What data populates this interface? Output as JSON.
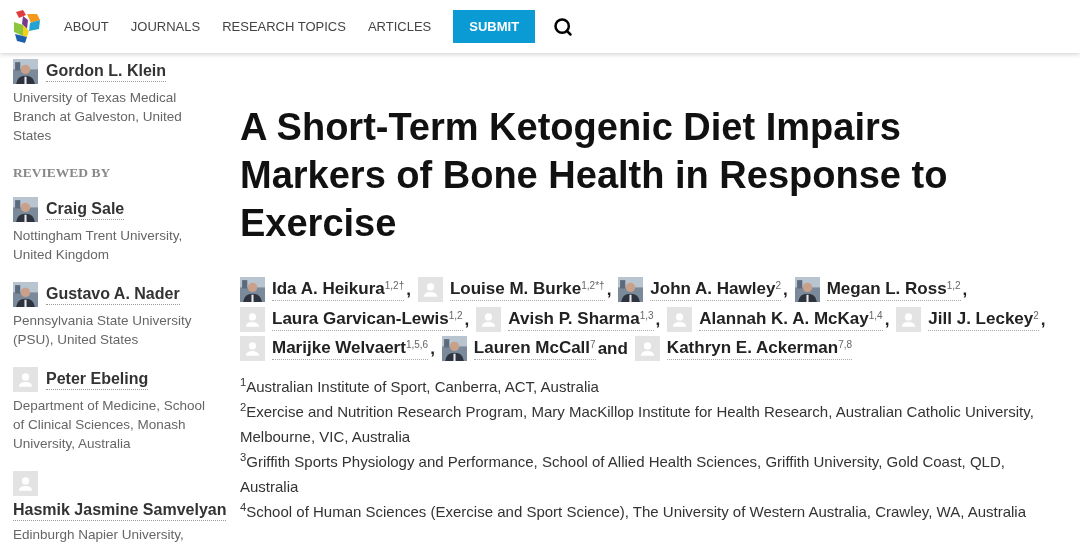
{
  "nav": {
    "items": [
      "ABOUT",
      "JOURNALS",
      "RESEARCH TOPICS",
      "ARTICLES"
    ],
    "submit": "SUBMIT"
  },
  "sidebar": {
    "edited_by": [
      {
        "name": "Gordon L. Klein",
        "affiliation": "University of Texas Medical Branch at Galveston, United States"
      }
    ],
    "reviewed_heading": "REVIEWED BY",
    "reviewers": [
      {
        "name": "Craig Sale",
        "affiliation": "Nottingham Trent University, United Kingdom"
      },
      {
        "name": "Gustavo A. Nader",
        "affiliation": "Pennsylvania State University (PSU), United States"
      },
      {
        "name": "Peter Ebeling",
        "affiliation": "Department of Medicine, School of Clinical Sciences, Monash University, Australia",
        "kind": "placeholder"
      },
      {
        "name": "Hasmik Jasmine Samvelyan",
        "affiliation": "Edinburgh Napier University,",
        "kind": "placeholder"
      }
    ]
  },
  "article": {
    "title": "A Short-Term Ketogenic Diet Impairs Markers of Bone Health in Response to Exercise",
    "authors": [
      {
        "name": "Ida A. Heikura",
        "sup": "1,2†",
        "sep": ","
      },
      {
        "name": "Louise M. Burke",
        "sup": "1,2*†",
        "sep": ",",
        "kind": "placeholder"
      },
      {
        "name": "John A. Hawley",
        "sup": "2",
        "sep": ","
      },
      {
        "name": "Megan L. Ross",
        "sup": "1,2",
        "sep": ","
      },
      {
        "name": "Laura Garvican-Lewis",
        "sup": "1,2",
        "sep": ",",
        "kind": "placeholder"
      },
      {
        "name": "Avish P. Sharma",
        "sup": "1,3",
        "sep": ",",
        "kind": "placeholder"
      },
      {
        "name": "Alannah K. A. McKay",
        "sup": "1,4",
        "sep": ",",
        "kind": "placeholder"
      },
      {
        "name": "Jill J. Leckey",
        "sup": "2",
        "sep": ",",
        "kind": "placeholder"
      },
      {
        "name": "Marijke Welvaert",
        "sup": "1,5,6",
        "sep": ",",
        "kind": "placeholder"
      },
      {
        "name": "Lauren McCall",
        "sup": "7",
        "sep": "and"
      },
      {
        "name": "Kathryn E. Ackerman",
        "sup": "7,8",
        "kind": "placeholder"
      }
    ],
    "affiliations": [
      "$^{1}$Australian Institute of Sport, Canberra, ACT, Australia",
      "$^{2}$Exercise and Nutrition Research Program, Mary MacKillop Institute for Health Research, Australian Catholic University, Melbourne, VIC, Australia",
      "$^{3}$Griffith Sports Physiology and Performance, School of Allied Health Sciences, Griffith University, Gold Coast, QLD, Australia",
      "$^{4}$School of Human Sciences (Exercise and Sport Science), The University of Western Australia, Crawley, WA, Australia"
    ]
  }
}
